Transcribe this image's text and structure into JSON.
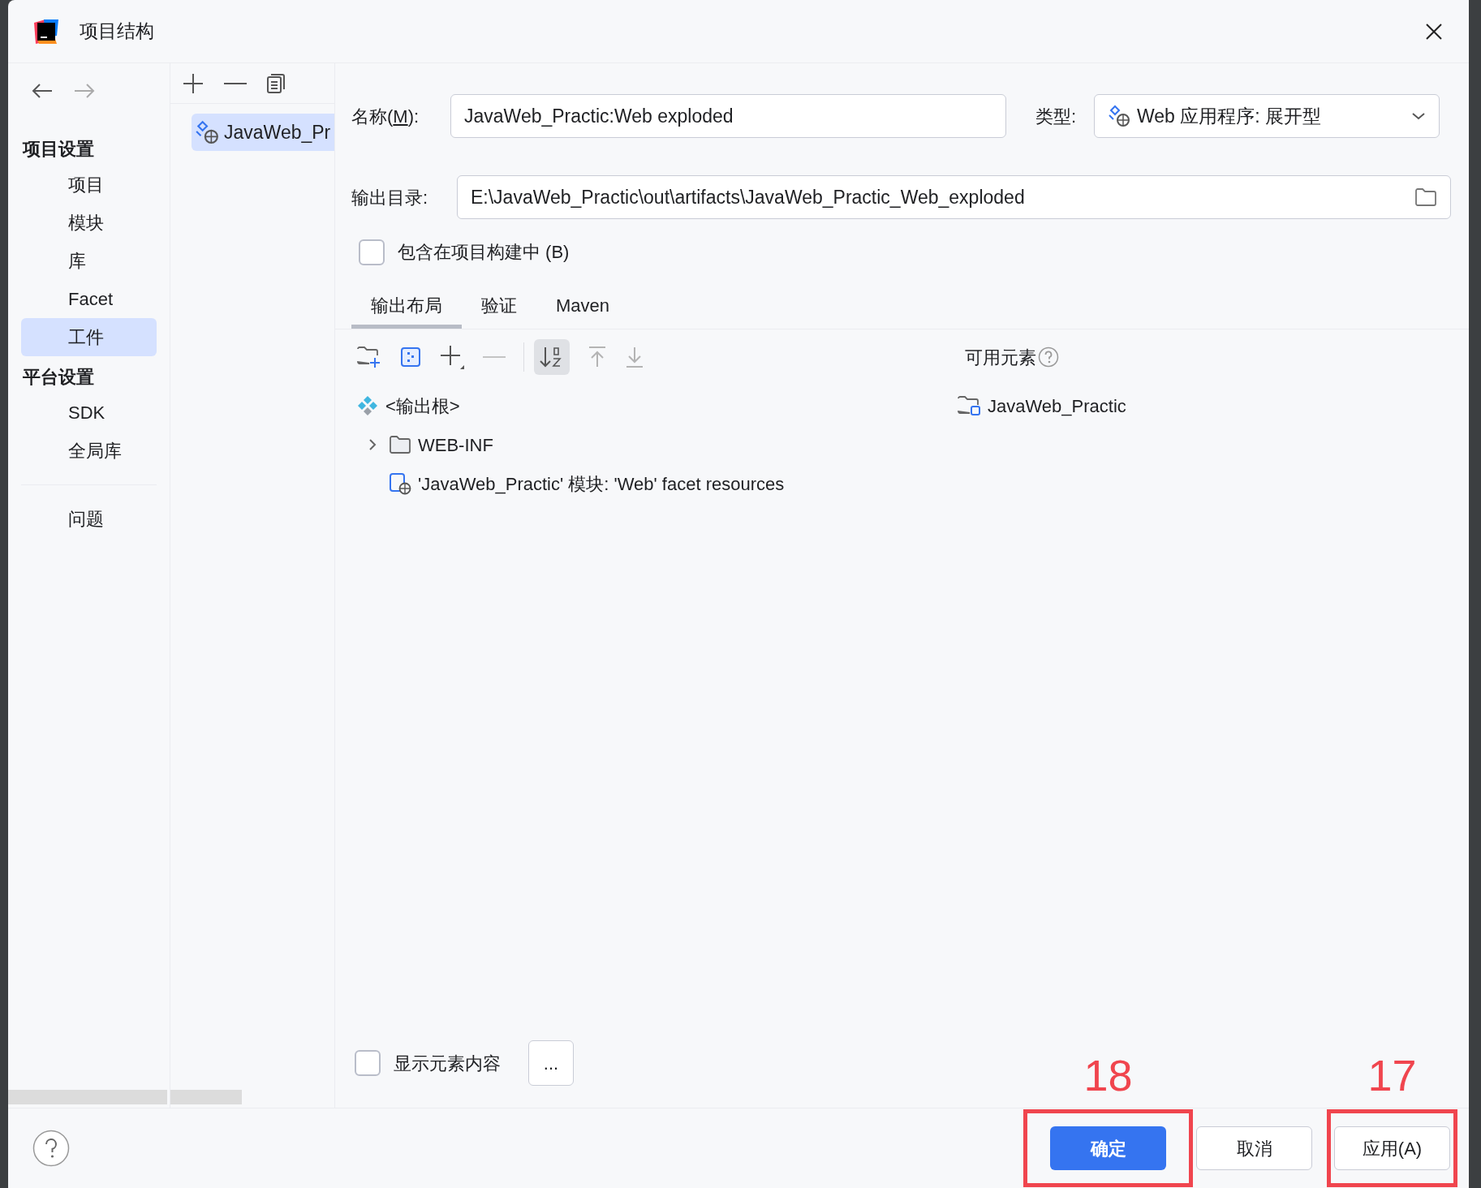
{
  "window": {
    "title": "项目结构"
  },
  "sidebar": {
    "sections": [
      {
        "heading": "项目设置",
        "items": [
          {
            "label": "项目",
            "selected": false
          },
          {
            "label": "模块",
            "selected": false
          },
          {
            "label": "库",
            "selected": false
          },
          {
            "label": "Facet",
            "selected": false
          },
          {
            "label": "工件",
            "selected": true
          }
        ]
      },
      {
        "heading": "平台设置",
        "items": [
          {
            "label": "SDK",
            "selected": false
          },
          {
            "label": "全局库",
            "selected": false
          }
        ]
      }
    ],
    "extra_items": [
      {
        "label": "问题",
        "selected": false
      }
    ]
  },
  "artifacts": [
    {
      "label": "JavaWeb_Pr",
      "selected": true
    }
  ],
  "form": {
    "name_label": {
      "before": "名称(",
      "mnemonic": "M",
      "after": "):"
    },
    "name_value": "JavaWeb_Practic:Web exploded",
    "type_label": "类型:",
    "type_value": "Web 应用程序: 展开型",
    "output_label": "输出目录:",
    "output_value": "E:\\JavaWeb_Practic\\out\\artifacts\\JavaWeb_Practic_Web_exploded",
    "include_in_build": {
      "label": "包含在项目构建中 (B)",
      "checked": false
    }
  },
  "tabs": [
    {
      "label": "输出布局",
      "selected": true
    },
    {
      "label": "验证",
      "selected": false
    },
    {
      "label": "Maven",
      "selected": false
    }
  ],
  "available_label": "可用元素",
  "layout_tree": [
    {
      "label": "<输出根>",
      "kind": "root",
      "children": [
        {
          "label": "WEB-INF",
          "kind": "folder",
          "expanded": false
        },
        {
          "label": "'JavaWeb_Practic' 模块: 'Web' facet resources",
          "kind": "facet"
        }
      ]
    }
  ],
  "available_tree": [
    {
      "label": "JavaWeb_Practic",
      "kind": "module"
    }
  ],
  "show_content": {
    "label": "显示元素内容",
    "checked": false
  },
  "more_button": "...",
  "buttons": [
    {
      "label": "确定",
      "primary": true,
      "annotation": "18"
    },
    {
      "label": "取消",
      "primary": false
    },
    {
      "label": "应用(A)",
      "primary": false,
      "annotation": "17"
    }
  ]
}
